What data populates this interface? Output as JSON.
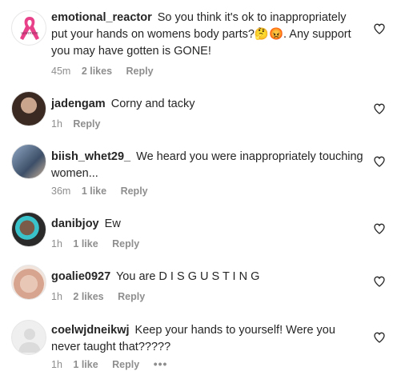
{
  "comments": [
    {
      "username": "emotional_reactor",
      "text": "So you think it's ok to inappropriately put your hands on womens body parts?🤔😡. Any support you may have gotten is GONE!",
      "time": "45m",
      "likes": "2 likes",
      "reply": "Reply",
      "avatar_icon": "pink-ribbon-icon"
    },
    {
      "username": "jadengam",
      "text": "Corny and tacky",
      "time": "1h",
      "likes": "",
      "reply": "Reply",
      "avatar_icon": "profile-photo"
    },
    {
      "username": "biish_whet29_",
      "text": "We heard you were inappropriately touching women...",
      "time": "36m",
      "likes": "1 like",
      "reply": "Reply",
      "avatar_icon": "profile-photo"
    },
    {
      "username": "danibjoy",
      "text": "Ew",
      "time": "1h",
      "likes": "1 like",
      "reply": "Reply",
      "avatar_icon": "profile-photo"
    },
    {
      "username": "goalie0927",
      "text": "You are D I S G U S T I N G",
      "time": "1h",
      "likes": "2 likes",
      "reply": "Reply",
      "avatar_icon": "profile-photo"
    },
    {
      "username": "coelwjdneikwj",
      "text": "Keep your hands to yourself! Were you never taught that?????",
      "time": "1h",
      "likes": "1 like",
      "reply": "Reply",
      "more": "•••",
      "avatar_icon": "default-avatar-icon"
    }
  ],
  "colors": {
    "text": "#262626",
    "muted": "#8e8e8e",
    "ribbon": "#e8418a"
  }
}
